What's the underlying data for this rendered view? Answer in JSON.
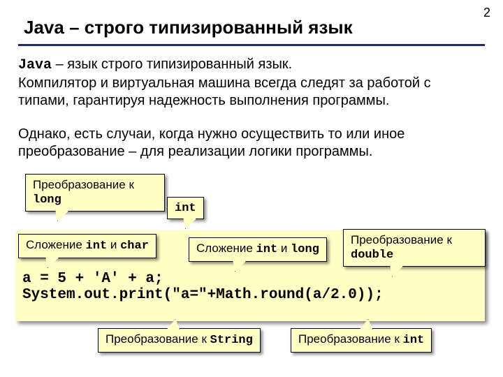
{
  "page_number": "2",
  "title": "Java – строго типизированный язык",
  "para1_lead": "Java",
  "para1_rest": " – язык строго типизированный язык.",
  "para1_line2": "Компилятор и виртуальная машина всегда следят за работой с типами, гарантируя надежность выполнения программы.",
  "para2": "Однако, есть случаи, когда нужно осуществить то или иное преобразование – для реализации логики программы.",
  "code": "a = 5 + 'A' + a;\nSystem.out.print(\"a=\"+Math.round(a/2.0));",
  "callouts": {
    "long_prefix": "Преобразование к ",
    "long_type": "long",
    "int_type": "int",
    "intchar_prefix": "Сложение ",
    "intchar_t1": "int",
    "intchar_mid": " и ",
    "intchar_t2": "char",
    "intlong_prefix": "Сложение ",
    "intlong_t1": "int",
    "intlong_mid": " и ",
    "intlong_t2": "long",
    "double_prefix": "Преобразование к ",
    "double_type": "double",
    "string_prefix": "Преобразование к ",
    "string_type": "String",
    "toint_prefix": "Преобразование к ",
    "toint_type": "int"
  }
}
